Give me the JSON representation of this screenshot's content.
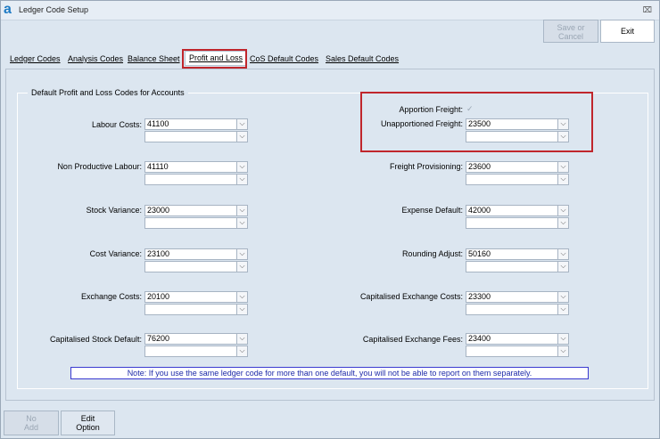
{
  "window": {
    "title": "Ledger Code Setup",
    "close_glyph": "⌧",
    "app_icon": "a"
  },
  "toolbar": {
    "save_label": "Save or",
    "cancel_label": "Cancel",
    "exit_label": "Exit"
  },
  "tabs": [
    {
      "label": "Ledger Codes"
    },
    {
      "label": "Analysis Codes"
    },
    {
      "label": "Balance Sheet"
    },
    {
      "label": "Profit and Loss"
    },
    {
      "label": "CoS Default Codes"
    },
    {
      "label": "Sales Default Codes"
    }
  ],
  "group_title": "Default Profit and Loss Codes for Accounts",
  "left_fields": [
    {
      "label": "Labour Costs:",
      "value": "41100"
    },
    {
      "label": "Non Productive Labour:",
      "value": "41110"
    },
    {
      "label": "Stock Variance:",
      "value": "23000"
    },
    {
      "label": "Cost Variance:",
      "value": "23100"
    },
    {
      "label": "Exchange Costs:",
      "value": "20100"
    },
    {
      "label": "Capitalised Stock Default:",
      "value": "76200"
    }
  ],
  "right_fields": [
    {
      "label": "Unapportioned Freight:",
      "value": "23500"
    },
    {
      "label": "Freight Provisioning:",
      "value": "23600"
    },
    {
      "label": "Expense Default:",
      "value": "42000"
    },
    {
      "label": "Rounding Adjust:",
      "value": "50160"
    },
    {
      "label": "Capitalised Exchange Costs:",
      "value": "23300"
    },
    {
      "label": "Capitalised Exchange Fees:",
      "value": "23400"
    }
  ],
  "apportion": {
    "label": "Apportion Freight:",
    "checked_glyph": "✓"
  },
  "dropdown_glyph": "⌵",
  "note": "Note: If you use the same ledger code for more than one default, you will not be able to report on them separately.",
  "bottom": {
    "no_label": "No",
    "add_label": "Add",
    "edit_label": "Edit",
    "option_label": "Option"
  }
}
